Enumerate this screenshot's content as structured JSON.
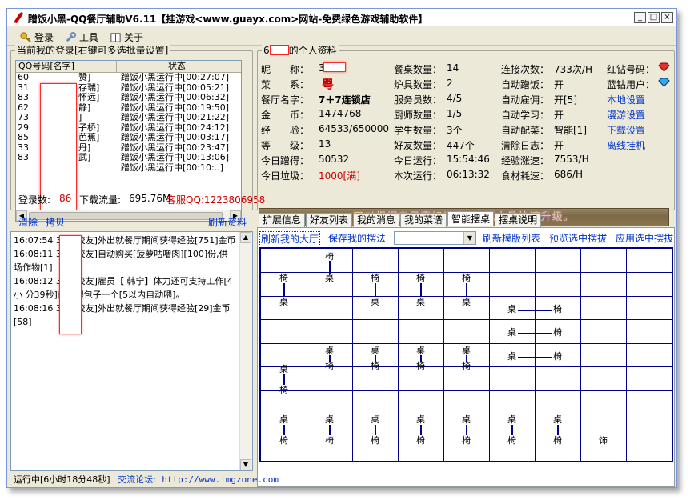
{
  "window": {
    "title": "蹭饭小黑-QQ餐厅辅助V6.11【挂游戏<www.guayx.com>网站-免费绿色游戏辅助软件】",
    "controls": [
      "_",
      "□",
      "×"
    ]
  },
  "menu": {
    "items": [
      {
        "label": "登录",
        "icon": "key-icon"
      },
      {
        "label": "工具",
        "icon": "wrench-icon"
      },
      {
        "label": "关于",
        "icon": "book-icon"
      }
    ]
  },
  "login_panel": {
    "title": "当前我的登录[右键可多选批量设置]",
    "columns": [
      "QQ号码[名字]",
      "状态"
    ],
    "rows": [
      {
        "qq": "60",
        "name": "赞]",
        "status": "蹭饭小黑运行中[00:27:07]"
      },
      {
        "qq": "31",
        "name": "存瑞]",
        "status": "蹭饭小黑运行中[00:05:21]"
      },
      {
        "qq": "83",
        "name": "怀远]",
        "status": "蹭饭小黑运行中[00:06:32]"
      },
      {
        "qq": "62",
        "name": "静]",
        "status": "蹭饭小黑运行中[00:19:50]"
      },
      {
        "qq": "73",
        "name": "]",
        "status": "蹭饭小黑运行中[00:21:22]"
      },
      {
        "qq": "29",
        "name": "子桥]",
        "status": "蹭饭小黑运行中[00:24:12]"
      },
      {
        "qq": "85",
        "name": "芭蕉]",
        "status": "蹭饭小黑运行中[00:03:17]"
      },
      {
        "qq": "33",
        "name": "丹]",
        "status": "蹭饭小黑运行中[00:23:47]"
      },
      {
        "qq": "83",
        "name": "武]",
        "status": "蹭饭小黑运行中[00:13:06]"
      },
      {
        "qq": "",
        "name": "]",
        "status": "蹭饭小黑运行中[00:10:..]"
      }
    ],
    "login_count_label": "登录数:",
    "login_count": "86",
    "download_label": "下载流量:",
    "download_value": "695.76M",
    "support_text": "客服QQ:1223806958"
  },
  "log_panel": {
    "clear": "清除",
    "copy": "拷贝",
    "refresh": "刷新资料",
    "lines": [
      "16:07:54 3 ：[校友]外出就餐厅期间获得经验[751]金币",
      "16:08:11 3 ：[校友]自动购买[菠萝咕噜肉][100]份,供 场作物[1]",
      "16:08:12 3 ：[校友]雇员【 韩宁】体力还可支持工作[4小 分39秒]自动喂包子一个[5以内自动喂]。",
      "16:08:16 3 ：[校友]外出就餐厅期间获得经验[29]金币[58]"
    ]
  },
  "profile": {
    "title_prefix": "6",
    "title_suffix": "的个人资料",
    "col1": [
      {
        "label": "昵　　称：",
        "value": "3"
      },
      {
        "label": "菜　　系：",
        "value": "粤"
      },
      {
        "label": "餐厅名字：",
        "value": "7＋7连锁店"
      },
      {
        "label": "金　　币：",
        "value": "1474768"
      },
      {
        "label": "经　　验：",
        "value": "64533/650000"
      },
      {
        "label": "等　　级：",
        "value": "13"
      },
      {
        "label": "今日蹭得：",
        "value": "50532"
      },
      {
        "label": "今日垃圾：",
        "value": "1000[满]"
      }
    ],
    "col2": [
      {
        "label": "餐桌数量：",
        "value": "14"
      },
      {
        "label": "炉具数量：",
        "value": "2"
      },
      {
        "label": "服务员数：",
        "value": "4/5"
      },
      {
        "label": "厨师数量：",
        "value": "1/5"
      },
      {
        "label": "学生数量：",
        "value": "3个"
      },
      {
        "label": "好友数量：",
        "value": "447个"
      },
      {
        "label": "今日运行：",
        "value": "15:54:46"
      },
      {
        "label": "本次运行：",
        "value": "06:13:32"
      }
    ],
    "col3": [
      {
        "label": "连接次数：",
        "value": "733次/H"
      },
      {
        "label": "自动蹭饭：",
        "value": "开"
      },
      {
        "label": "自动雇佣：",
        "value": "开[5]"
      },
      {
        "label": "自动学习：",
        "value": "开"
      },
      {
        "label": "自动配菜：",
        "value": "智能[1]"
      },
      {
        "label": "清除日志：",
        "value": "开"
      },
      {
        "label": "经验涨速：",
        "value": "7553/H"
      },
      {
        "label": "食材耗速：",
        "value": "686/H"
      }
    ],
    "col4": [
      {
        "label": "红钻号码：",
        "icon": "red-diamond-icon"
      },
      {
        "label": "蓝钻用户：",
        "icon": "blue-diamond-icon"
      },
      {
        "link": "本地设置"
      },
      {
        "link": "漫游设置"
      },
      {
        "link": "下载设置"
      },
      {
        "link": "离线挂机"
      }
    ],
    "banner": "可以根据自己喜好设置, 实现大号快速升级。"
  },
  "tabs": [
    "扩展信息",
    "好友列表",
    "我的消息",
    "我的菜谱",
    "智能摆桌",
    "摆桌说明"
  ],
  "active_tab": 4,
  "layout_toolbar": {
    "refresh_hall": "刷新我的大厅",
    "save_layout": "保存我的摆法",
    "combo_value": "",
    "refresh_templates": "刷新模版列表",
    "preview": "预览选中摆拔",
    "apply": "应用选中摆拔"
  },
  "board": {
    "table_label": "桌",
    "chair_label": "椅",
    "deco_label": "饰"
  },
  "status": {
    "running": "运行中[6小时18分48秒]",
    "forum_label": "交流论坛:",
    "forum_url": "http://www.imgzone.com"
  },
  "colors": {
    "accent_link": "#0033cc",
    "red_value": "#cc0000",
    "board_line": "#00008b"
  }
}
